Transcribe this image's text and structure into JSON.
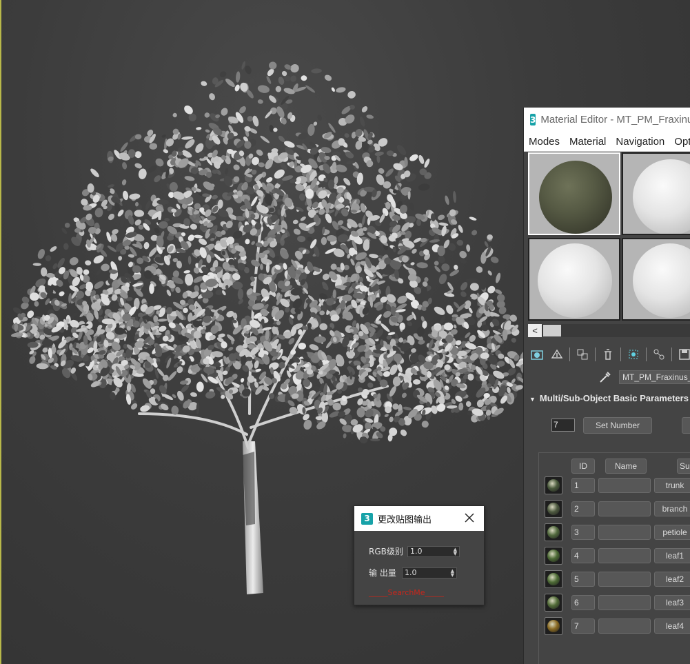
{
  "dialog": {
    "title": "更改贴图输出",
    "rgb_label": "RGB级别",
    "rgb_value": "1.0",
    "output_label": "输 出量",
    "output_value": "1.0",
    "link_text": "_____SearchMe_____"
  },
  "material_editor": {
    "logo": "3",
    "title": "Material Editor - MT_PM_Fraxinus",
    "menu": [
      "Modes",
      "Material",
      "Navigation",
      "Options"
    ],
    "scroll_left_label": "<",
    "material_name": "MT_PM_Fraxinus_",
    "rollout_title": "Multi/Sub-Object Basic Parameters",
    "rollout_toggle_icon": "triangle-down-icon",
    "count_value": "7",
    "set_number_label": "Set Number",
    "table_headers": {
      "id": "ID",
      "name": "Name",
      "sub": "Sub-Material"
    },
    "rows": [
      {
        "id": "1",
        "name": "",
        "sub": "trunk",
        "color": "#4a5a3c"
      },
      {
        "id": "2",
        "name": "",
        "sub": "branch",
        "color": "#4e5a40"
      },
      {
        "id": "3",
        "name": "",
        "sub": "petiole",
        "color": "#526a3e"
      },
      {
        "id": "4",
        "name": "",
        "sub": "leaf1",
        "color": "#4c6a34"
      },
      {
        "id": "5",
        "name": "",
        "sub": "leaf2",
        "color": "#4e6c36"
      },
      {
        "id": "6",
        "name": "",
        "sub": "leaf3",
        "color": "#526c38"
      },
      {
        "id": "7",
        "name": "",
        "sub": "leaf4",
        "color": "#8a6a22"
      }
    ]
  },
  "colors": {
    "viewport_bg": "#3c3c3c",
    "panel_bg": "#444444",
    "accent_logo": "#17a2a8",
    "link_red": "#c8261c"
  }
}
